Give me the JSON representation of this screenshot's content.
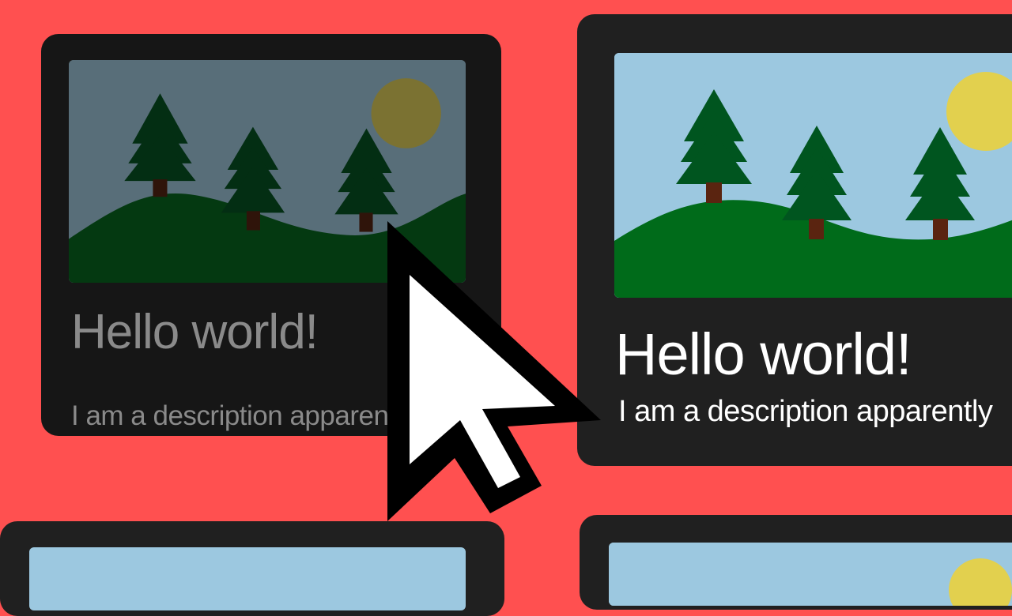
{
  "cards": [
    {
      "title": "Hello world!",
      "description": "I am a description apparently"
    },
    {
      "title": "Hello world!",
      "description": "I am a description apparently"
    }
  ],
  "colors": {
    "background": "#ff5050",
    "card": "#202020",
    "sky": "#9cc8e0",
    "sun": "#e2d04e",
    "hill": "#006b1a",
    "tree": "#00551f",
    "trunk": "#5a2410"
  },
  "icons": {
    "pointer": "mouse-pointer-icon"
  }
}
